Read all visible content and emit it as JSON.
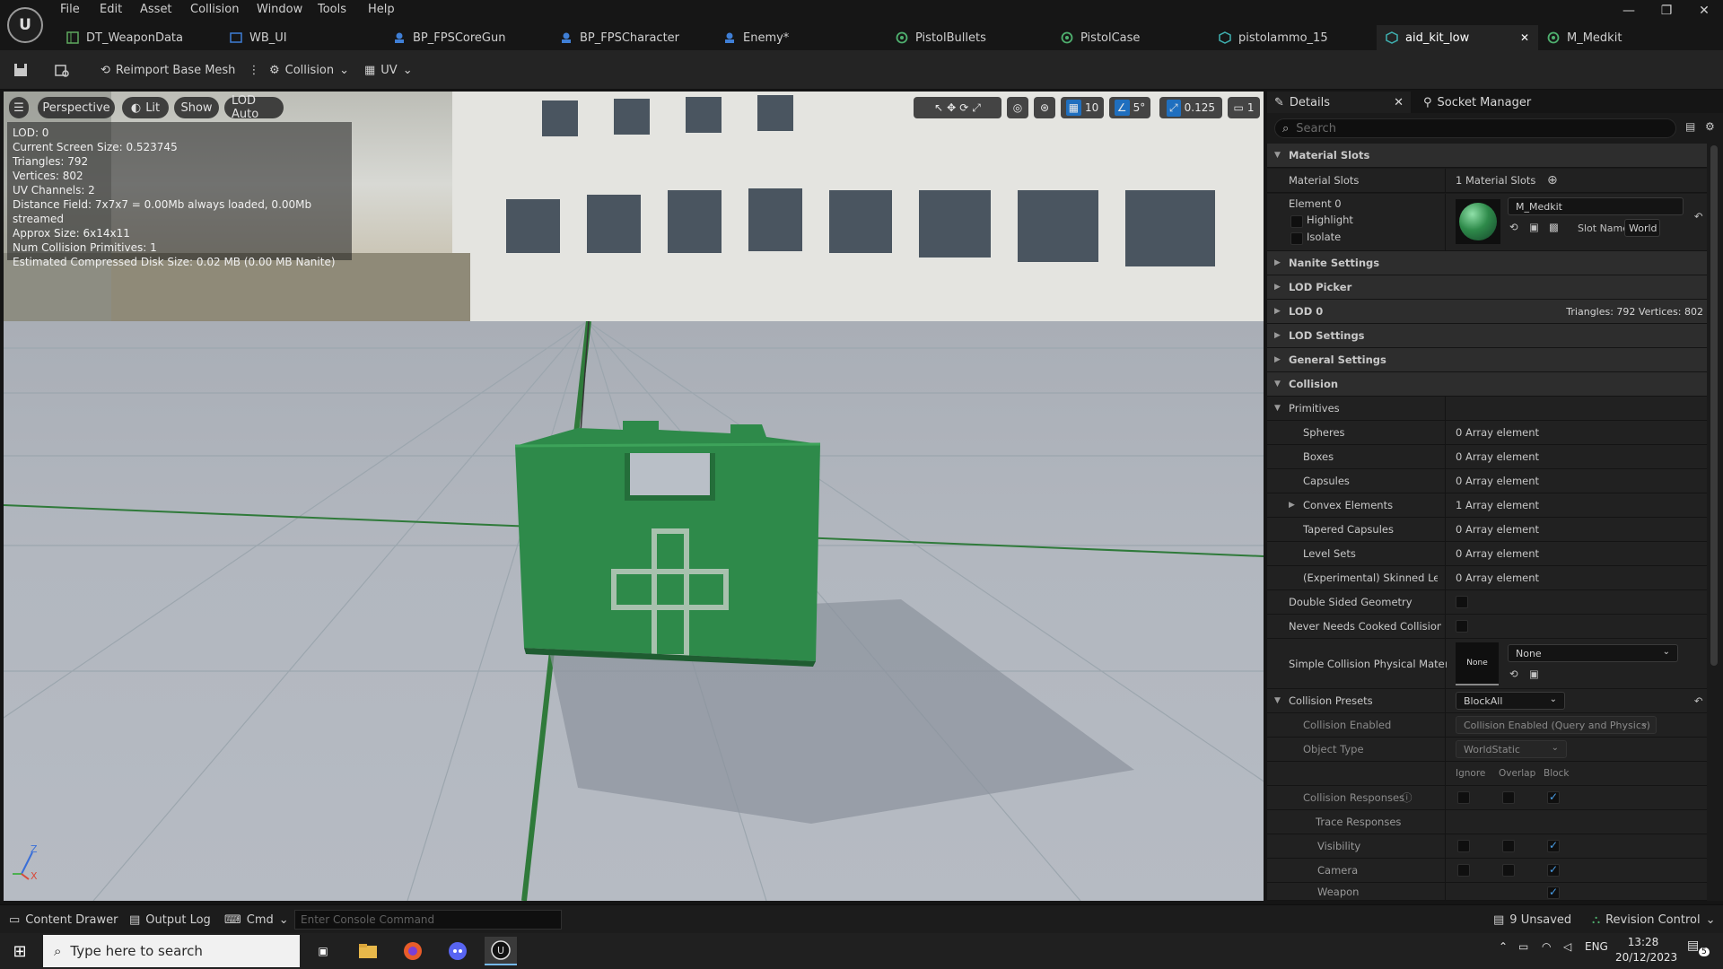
{
  "app": {
    "menu": [
      "File",
      "Edit",
      "Asset",
      "Collision",
      "Window",
      "Tools",
      "Help"
    ],
    "tabs": [
      {
        "label": "DT_WeaponData",
        "icon": "datatable-icon",
        "color": "#5fa85f"
      },
      {
        "label": "WB_UI",
        "icon": "widget-blueprint-icon",
        "color": "#3f7fd6"
      },
      {
        "label": "BP_FPSCoreGun",
        "icon": "blueprint-icon",
        "color": "#3f7fd6"
      },
      {
        "label": "BP_FPSCharacter",
        "icon": "blueprint-icon",
        "color": "#3f7fd6"
      },
      {
        "label": "Enemy*",
        "icon": "blueprint-icon",
        "color": "#3f7fd6"
      },
      {
        "label": "PistolBullets",
        "icon": "material-icon",
        "color": "#4fb06f"
      },
      {
        "label": "PistolCase",
        "icon": "material-icon",
        "color": "#4fb06f"
      },
      {
        "label": "pistolammo_15",
        "icon": "static-mesh-icon",
        "color": "#3fb0b0"
      },
      {
        "label": "aid_kit_low",
        "icon": "static-mesh-icon",
        "color": "#3fb0b0"
      },
      {
        "label": "M_Medkit",
        "icon": "material-icon",
        "color": "#4fb06f"
      }
    ],
    "active_tab": "aid_kit_low"
  },
  "toolbar": {
    "reimport_label": "Reimport Base Mesh",
    "collision_label": "Collision",
    "uv_label": "UV"
  },
  "viewport": {
    "perspective_label": "Perspective",
    "lit_label": "Lit",
    "show_label": "Show",
    "lod_label": "LOD Auto",
    "grid_snap": "10",
    "rotation_snap": "5°",
    "scale_snap": "0.125",
    "camera_speed": "1",
    "stats": [
      "LOD:  0",
      "Current Screen Size:  0.523745",
      "Triangles:  792",
      "Vertices:  802",
      "UV Channels:  2",
      "Distance Field:  7x7x7 = 0.00Mb always loaded, 0.00Mb streamed",
      "Approx Size: 6x14x11",
      "Num Collision Primitives:  1",
      "Estimated Compressed Disk Size: 0.02 MB (0.00 MB Nanite)"
    ],
    "axis_z": "Z",
    "axis_x": "X"
  },
  "details": {
    "tab_label": "Details",
    "socket_tab_label": "Socket Manager",
    "search_placeholder": "Search",
    "material_slots_cat": "Material Slots",
    "material_slots_name": "Material Slots",
    "material_slots_value": "1 Material Slots",
    "element0": "Element 0",
    "highlight": "Highlight",
    "isolate": "Isolate",
    "material_name": "M_Medkit",
    "slot_name_label": "Slot Name",
    "slot_name_value": "World",
    "nanite_cat": "Nanite Settings",
    "lod_picker_cat": "LOD Picker",
    "lod0_cat": "LOD 0",
    "lod0_info": "Triangles: 792   Vertices: 802",
    "lod_settings_cat": "LOD Settings",
    "general_settings_cat": "General Settings",
    "collision_cat": "Collision",
    "primitives": "Primitives",
    "primitive_rows": [
      {
        "name": "Spheres",
        "value": "0 Array element"
      },
      {
        "name": "Boxes",
        "value": "0 Array element"
      },
      {
        "name": "Capsules",
        "value": "0 Array element"
      },
      {
        "name": "Convex Elements",
        "value": "1 Array element"
      },
      {
        "name": "Tapered Capsules",
        "value": "0 Array element"
      },
      {
        "name": "Level Sets",
        "value": "0 Array element"
      },
      {
        "name": "(Experimental) Skinned Level...",
        "value": "0 Array element"
      }
    ],
    "double_sided": "Double Sided Geometry",
    "never_cooked": "Never Needs Cooked Collision D...",
    "simple_phys_mat": "Simple Collision Physical Material",
    "phys_mat_thumb": "None",
    "phys_mat_value": "None",
    "collision_presets": "Collision Presets",
    "collision_presets_value": "BlockAll",
    "collision_enabled": "Collision Enabled",
    "collision_enabled_value": "Collision Enabled (Query and Physics)",
    "object_type": "Object Type",
    "object_type_value": "WorldStatic",
    "resp_headers": [
      "Ignore",
      "Overlap",
      "Block"
    ],
    "collision_responses": "Collision Responses",
    "trace_responses": "Trace Responses",
    "visibility": "Visibility",
    "camera": "Camera",
    "weapon": "Weapon"
  },
  "bottom": {
    "content_drawer": "Content Drawer",
    "output_log": "Output Log",
    "cmd": "Cmd",
    "console_placeholder": "Enter Console Command",
    "unsaved": "9 Unsaved",
    "revision_control": "Revision Control"
  },
  "taskbar": {
    "search_placeholder": "Type here to search",
    "lang": "ENG",
    "time": "13:28",
    "date": "20/12/2023",
    "notification_count": "5"
  },
  "colors": {
    "accent_blue": "#1f6fbf",
    "medkit_green": "#2e8a4a"
  }
}
